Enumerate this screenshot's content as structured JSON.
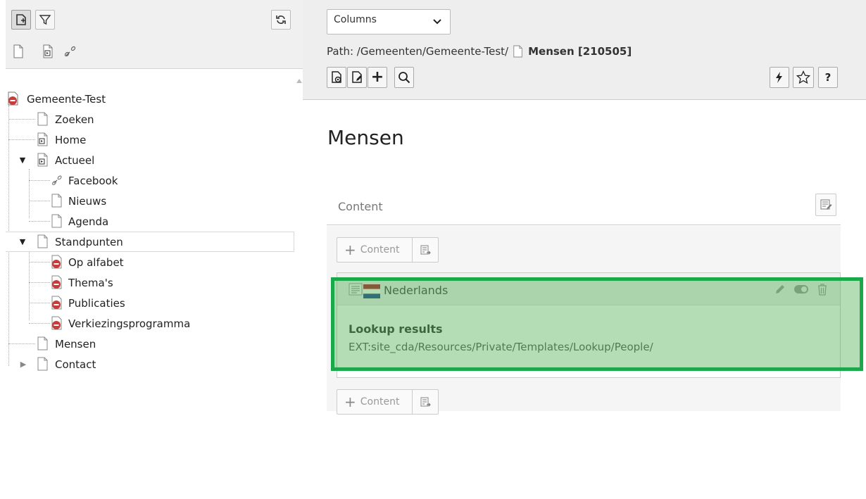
{
  "tree": {
    "toolbar": {
      "new_page_tooltip": "New page",
      "filter_tooltip": "Filter",
      "refresh_tooltip": "Refresh"
    },
    "nodes": [
      {
        "label": "Gemeente-Test",
        "icon": "site-root-icon",
        "level": 0
      },
      {
        "label": "Zoeken",
        "icon": "page-icon",
        "level": 1
      },
      {
        "label": "Home",
        "icon": "shortcut-page-icon",
        "level": 1
      },
      {
        "label": "Actueel",
        "icon": "shortcut-page-icon",
        "level": 1,
        "expanded": true
      },
      {
        "label": "Facebook",
        "icon": "link-icon",
        "level": 2
      },
      {
        "label": "Nieuws",
        "icon": "page-icon",
        "level": 2
      },
      {
        "label": "Agenda",
        "icon": "page-icon",
        "level": 2
      },
      {
        "label": "Standpunten",
        "icon": "page-icon",
        "level": 1,
        "expanded": true
      },
      {
        "label": "Op alfabet",
        "icon": "restricted-page-icon",
        "level": 2
      },
      {
        "label": "Thema's",
        "icon": "restricted-page-icon",
        "level": 2
      },
      {
        "label": "Publicaties",
        "icon": "restricted-page-icon",
        "level": 2
      },
      {
        "label": "Verkiezingsprogramma",
        "icon": "restricted-page-icon",
        "level": 2
      },
      {
        "label": "Mensen",
        "icon": "page-icon",
        "level": 1
      },
      {
        "label": "Contact",
        "icon": "page-icon",
        "level": 1,
        "collapsed": true
      }
    ]
  },
  "module": {
    "view_select": {
      "value": "Columns"
    },
    "path": {
      "prefix": "Path: /Gemeenten/Gemeente-Test/",
      "current": "Mensen [210505]"
    },
    "page_title": "Mensen",
    "grid": {
      "column_label": "Content",
      "new_content_label": "Content",
      "element": {
        "language": "Nederlands",
        "title": "Lookup results",
        "subtitle": "EXT:site_cda/Resources/Private/Templates/Lookup/People/"
      }
    },
    "help_label": "?"
  },
  "colors": {
    "highlight": "#1aa84a",
    "restricted": "#c83c3c"
  }
}
